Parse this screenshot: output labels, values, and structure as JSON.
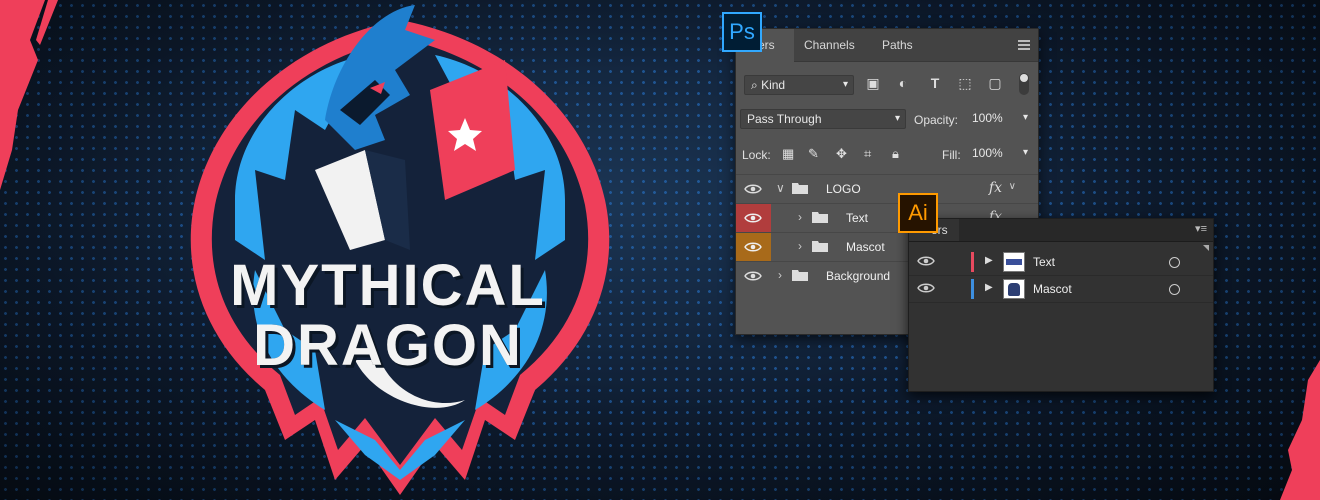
{
  "poster": {
    "title_line1": "MYTHICAL",
    "title_line2": "DRAGON",
    "colors": {
      "background": "#0d1a2c",
      "accent_red": "#ef3f5a",
      "accent_blue": "#2fa6f0",
      "dark_navy": "#14223a"
    }
  },
  "photoshop": {
    "badge": "Ps",
    "tabs": [
      "ers",
      "Channels",
      "Paths"
    ],
    "filter": {
      "label": "Kind"
    },
    "blend": {
      "mode": "Pass Through",
      "opacity_label": "Opacity:",
      "opacity_value": "100%"
    },
    "lock": {
      "label": "Lock:",
      "fill_label": "Fill:",
      "fill_value": "100%"
    },
    "layers": [
      {
        "name": "LOGO",
        "fx": "fx",
        "eye_color": "#535353"
      },
      {
        "name": "Text",
        "fx": "fx",
        "eye_color": "#b13d3d"
      },
      {
        "name": "Mascot",
        "fx": "",
        "eye_color": "#a86a1a"
      },
      {
        "name": "Background",
        "fx": "",
        "eye_color": "#535353"
      }
    ]
  },
  "illustrator": {
    "badge": "Ai",
    "tab": "ers",
    "layers": [
      {
        "name": "Text",
        "color": "#e84a5f"
      },
      {
        "name": "Mascot",
        "color": "#3d8fe0"
      }
    ]
  }
}
